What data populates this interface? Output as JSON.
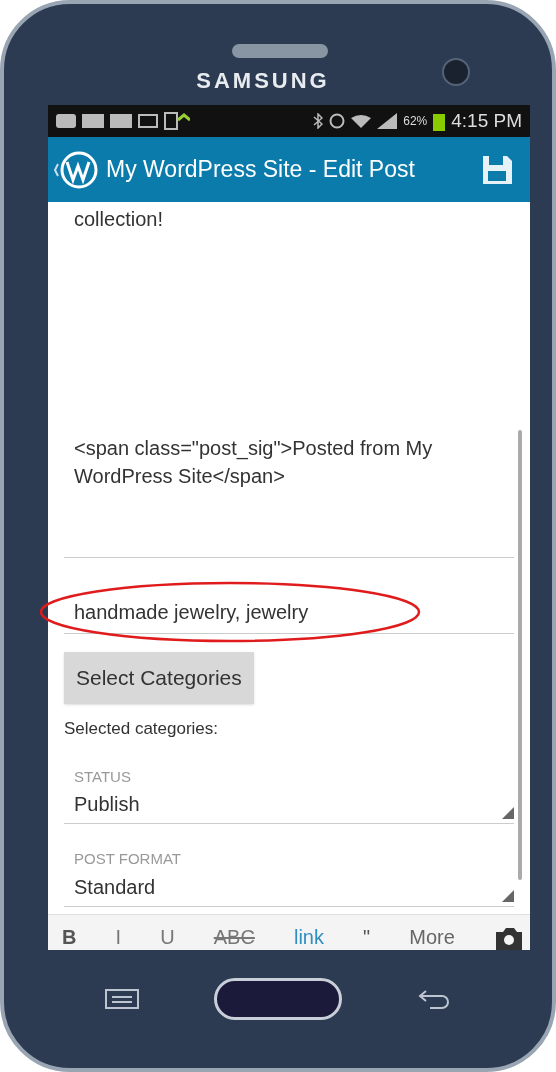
{
  "device": {
    "brand": "SAMSUNG"
  },
  "status_bar": {
    "battery": "62%",
    "time": "4:15 PM"
  },
  "app_bar": {
    "title": "My WordPress Site - Edit Post"
  },
  "editor": {
    "lines": [
      "collection!",
      "<span class=\"post_sig\">Posted from My WordPress Site</span>"
    ]
  },
  "tags_field": {
    "value": "handmade jewelry, jewelry"
  },
  "select_categories_button": "Select Categories",
  "selected_categories_label": "Selected categories:",
  "selects": [
    {
      "label": "STATUS",
      "value": "Publish"
    },
    {
      "label": "POST FORMAT",
      "value": "Standard"
    }
  ],
  "format_toolbar": [
    {
      "kind": "bold",
      "label": "B"
    },
    {
      "kind": "italic",
      "label": "I"
    },
    {
      "kind": "underline",
      "label": "U"
    },
    {
      "kind": "strike",
      "label": "ABC"
    },
    {
      "kind": "link",
      "label": "link"
    },
    {
      "kind": "quote",
      "label": "\""
    },
    {
      "kind": "more",
      "label": "More"
    }
  ]
}
